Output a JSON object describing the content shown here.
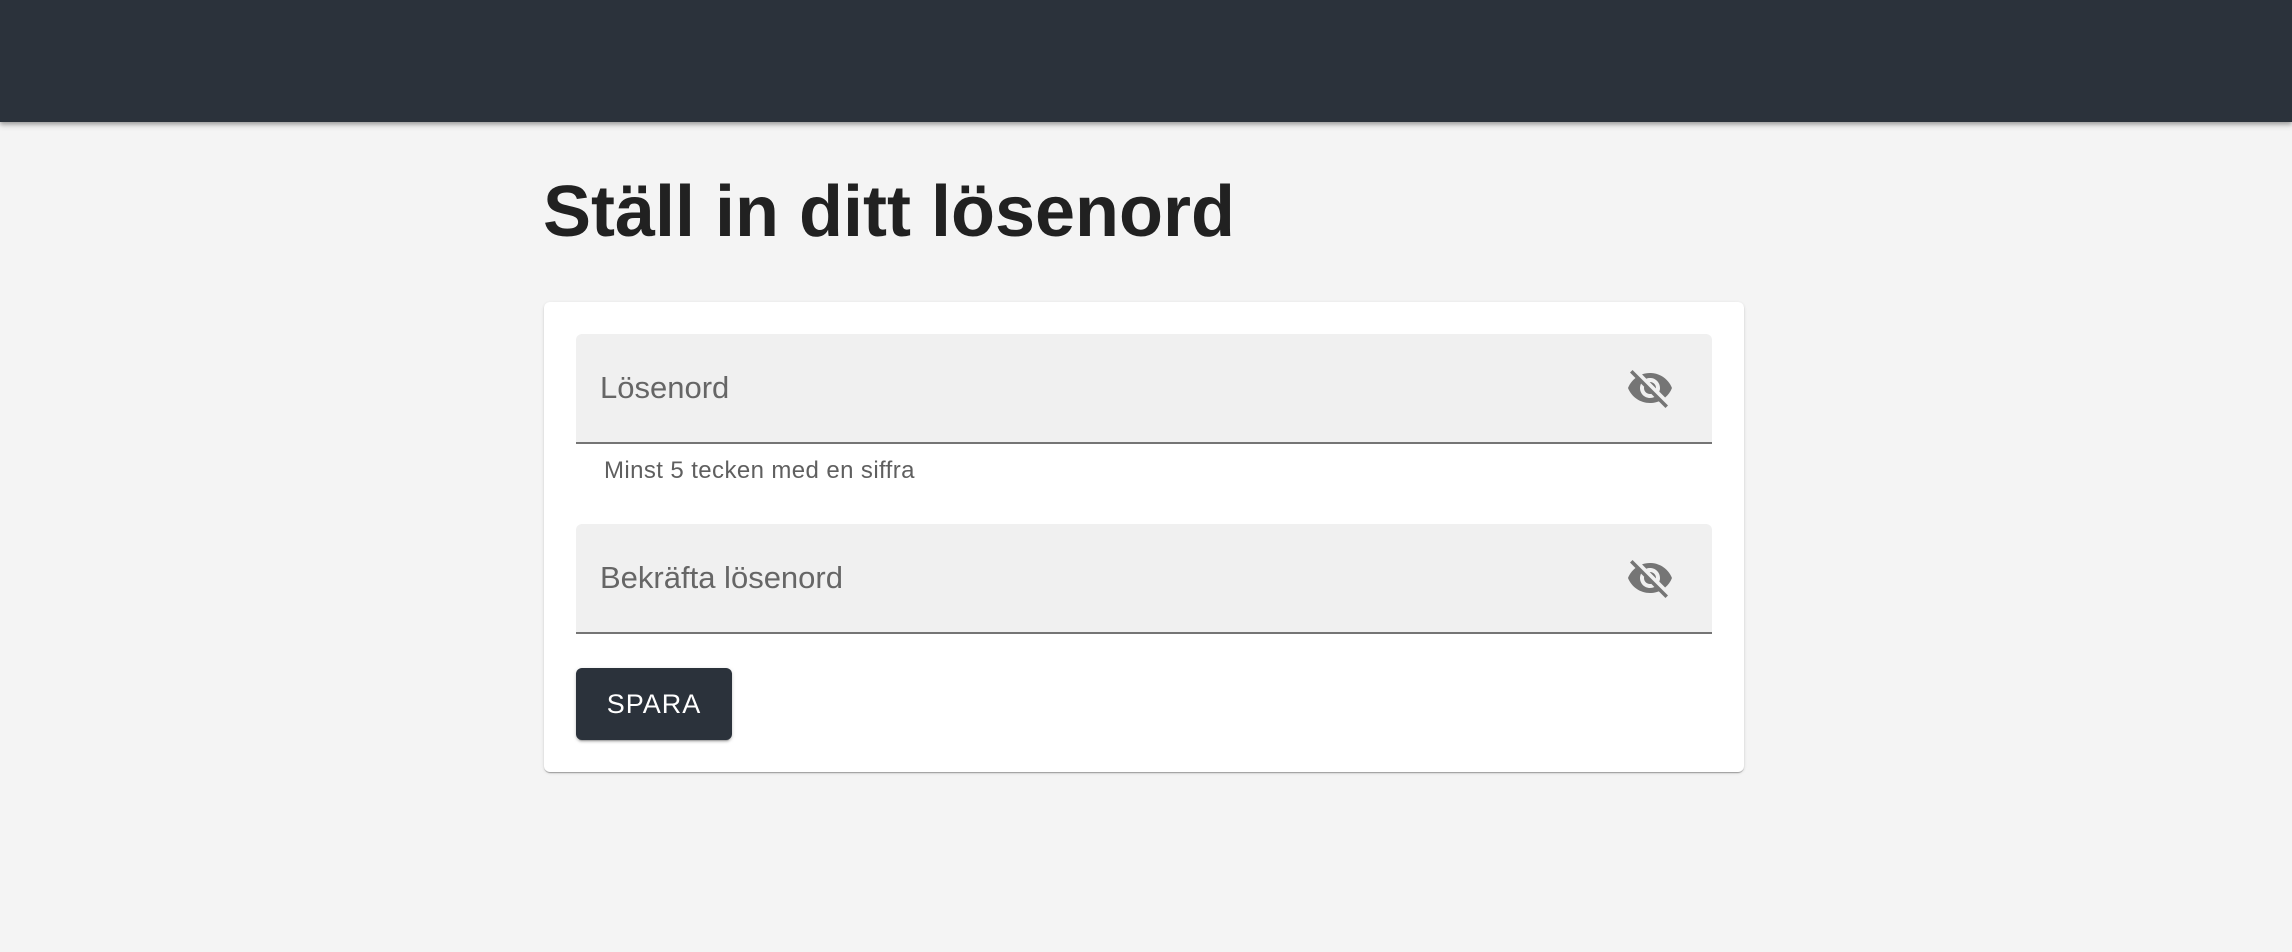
{
  "page": {
    "title": "Ställ in ditt lösenord"
  },
  "form": {
    "password": {
      "placeholder": "Lösenord",
      "value": "",
      "helper": "Minst 5 tecken med en siffra",
      "visibility_icon": "eye-off-icon"
    },
    "confirm_password": {
      "placeholder": "Bekräfta lösenord",
      "value": "",
      "visibility_icon": "eye-off-icon"
    },
    "save_label": "SPARA"
  },
  "colors": {
    "app_bar": "#2b323b",
    "background": "#f4f4f4",
    "field_fill": "#f0f0f0",
    "button": "#2b323b",
    "icon": "#757575"
  }
}
